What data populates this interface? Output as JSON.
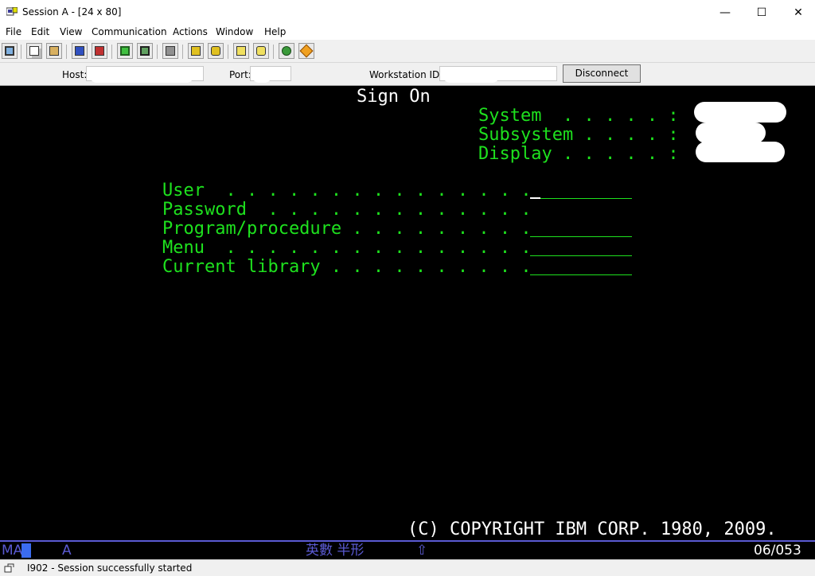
{
  "window": {
    "title": "Session A - [24 x 80]",
    "controls": {
      "minimize": "—",
      "maximize": "☐",
      "close": "✕"
    }
  },
  "menu": [
    "File",
    "Edit",
    "View",
    "Communication",
    "Actions",
    "Window",
    "Help"
  ],
  "toolbar_icons": [
    "print-screen-icon",
    "copy-icon",
    "paste-icon",
    "send-file-icon",
    "receive-file-icon",
    "display-icon",
    "display-alt-icon",
    "keyboard-icon",
    "macro-record-icon",
    "macro-play-icon",
    "macro-icon",
    "macro-alt-icon",
    "web-browser-icon",
    "edit-icon"
  ],
  "connection": {
    "host_label": "Host:",
    "port_label": "Port:",
    "workstation_label": "Workstation ID:",
    "disconnect_label": "Disconnect"
  },
  "screen": {
    "title": "Sign On",
    "system_label": "System  . . . . . :",
    "subsystem_label": "Subsystem . . . . :",
    "display_label": "Display . . . . . :",
    "fields": [
      {
        "label": "User  . . . . . . . . . . . . . . ."
      },
      {
        "label": "Password  . . . . . . . . . . . . ."
      },
      {
        "label": "Program/procedure . . . . . . . . ."
      },
      {
        "label": "Menu  . . . . . . . . . . . . . . ."
      },
      {
        "label": "Current library . . . . . . . . . ."
      }
    ],
    "copyright": "(C) COPYRIGHT IBM CORP. 1980, 2009."
  },
  "oia": {
    "left": "MA",
    "mode": "A",
    "input_mode": "英數 半形",
    "shift_glyph": "⇧",
    "position": "06/053"
  },
  "status": {
    "message": "I902 - Session successfully started"
  },
  "colors": {
    "screen_bg": "#000000",
    "field_text": "#1ee11e",
    "title_text": "#ffffff",
    "oia_text": "#5a5ad2",
    "oia_cursor": "#3b6cf0"
  }
}
